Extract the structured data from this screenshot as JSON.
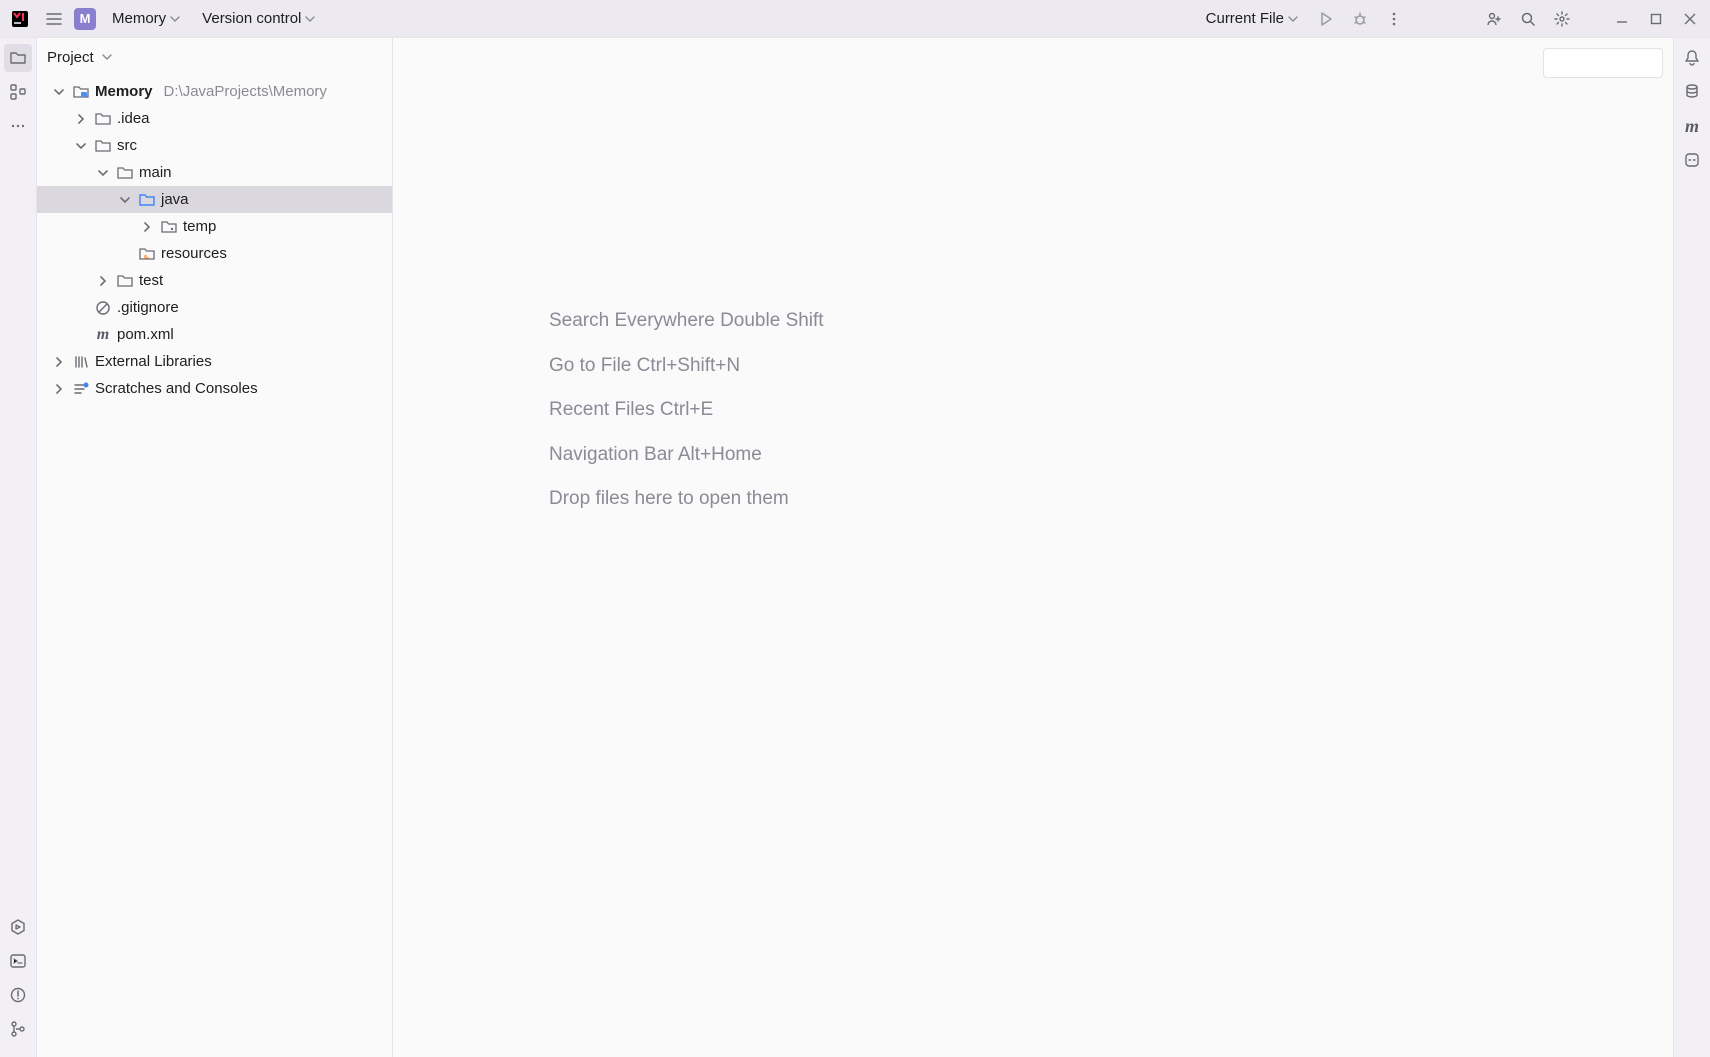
{
  "topbar": {
    "project_badge": "M",
    "project_name": "Memory",
    "vcs_label": "Version control",
    "run_config_label": "Current File"
  },
  "project_panel": {
    "title": "Project"
  },
  "tree": {
    "root": {
      "name": "Memory",
      "path": "D:\\JavaProjects\\Memory"
    },
    "idea": ".idea",
    "src": "src",
    "main": "main",
    "java": "java",
    "temp": "temp",
    "resources": "resources",
    "test": "test",
    "gitignore": ".gitignore",
    "pom": "pom.xml",
    "ext_libs": "External Libraries",
    "scratches": "Scratches and Consoles"
  },
  "hints": {
    "search": "Search Everywhere Double Shift",
    "goto": "Go to File Ctrl+Shift+N",
    "recent": "Recent Files Ctrl+E",
    "navbar": "Navigation Bar Alt+Home",
    "drop": "Drop files here to open them"
  }
}
